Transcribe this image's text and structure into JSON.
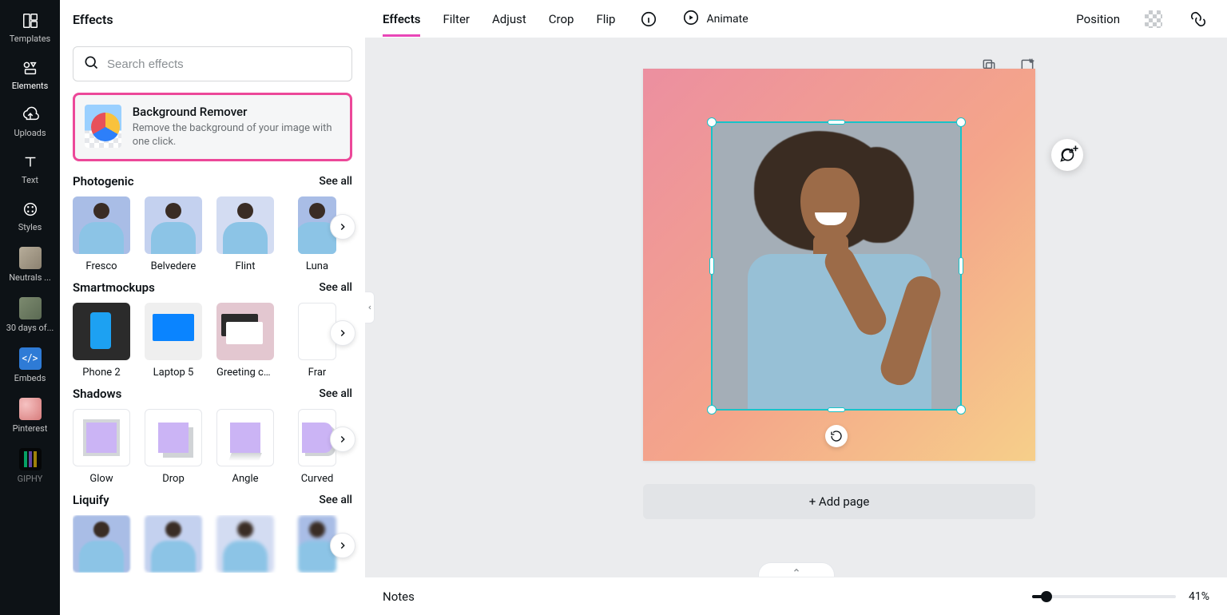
{
  "iconbar": {
    "items": [
      {
        "label": "Templates"
      },
      {
        "label": "Elements"
      },
      {
        "label": "Uploads"
      },
      {
        "label": "Text"
      },
      {
        "label": "Styles"
      },
      {
        "label": "Neutrals ..."
      },
      {
        "label": "30 days of..."
      },
      {
        "label": "Embeds"
      },
      {
        "label": "Pinterest"
      },
      {
        "label": "GIPHY"
      }
    ]
  },
  "panel": {
    "title": "Effects",
    "search_placeholder": "Search effects",
    "bg_remover": {
      "title": "Background Remover",
      "desc": "Remove the background of your image with one click."
    },
    "see_all": "See all",
    "sections": {
      "photogenic": {
        "title": "Photogenic",
        "items": [
          "Fresco",
          "Belvedere",
          "Flint",
          "Luna"
        ]
      },
      "smartmockups": {
        "title": "Smartmockups",
        "items": [
          "Phone 2",
          "Laptop 5",
          "Greeting car...",
          "Frar"
        ]
      },
      "shadows": {
        "title": "Shadows",
        "items": [
          "Glow",
          "Drop",
          "Angle",
          "Curved"
        ]
      },
      "liquify": {
        "title": "Liquify"
      }
    }
  },
  "toolbar": {
    "tabs": [
      "Effects",
      "Filter",
      "Adjust",
      "Crop",
      "Flip"
    ],
    "animate": "Animate",
    "position": "Position"
  },
  "canvas": {
    "add_page": "+ Add page"
  },
  "footer": {
    "notes": "Notes",
    "zoom": "41%"
  }
}
